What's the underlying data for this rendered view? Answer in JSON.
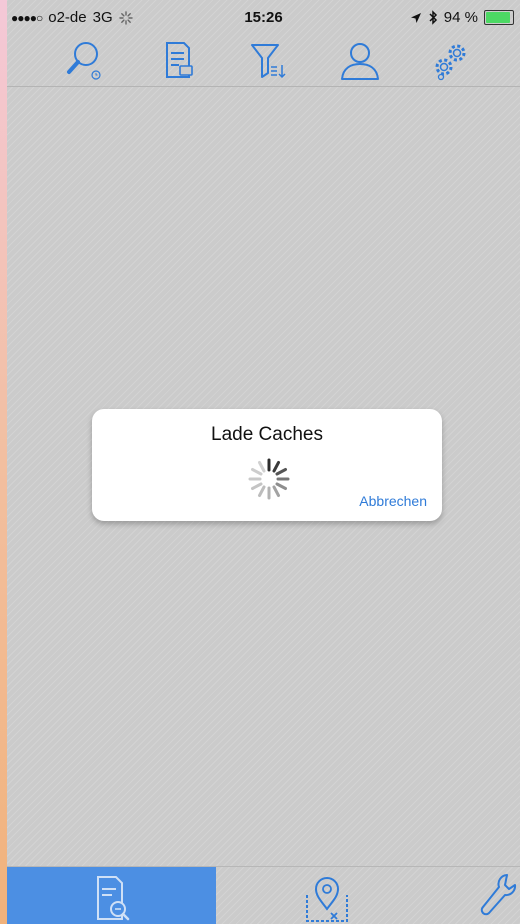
{
  "status_bar": {
    "signal": "●●●●○",
    "carrier": "o2-de",
    "network": "3G",
    "time": "15:26",
    "battery_percent": "94 %",
    "battery_level": 0.94
  },
  "toolbar": {
    "icons": [
      "search-history-icon",
      "list-icon",
      "filter-sort-icon",
      "user-icon",
      "settings-icon"
    ]
  },
  "dialog": {
    "title": "Lade Caches",
    "cancel_label": "Abbrechen"
  },
  "tabbar": {
    "icons": [
      "search-list-icon",
      "map-pin-icon",
      "wrench-icon"
    ],
    "active_index": 0
  },
  "colors": {
    "accent": "#2f7bd8",
    "active_tab": "#4c8fe3",
    "background": "#cbcbcb"
  }
}
